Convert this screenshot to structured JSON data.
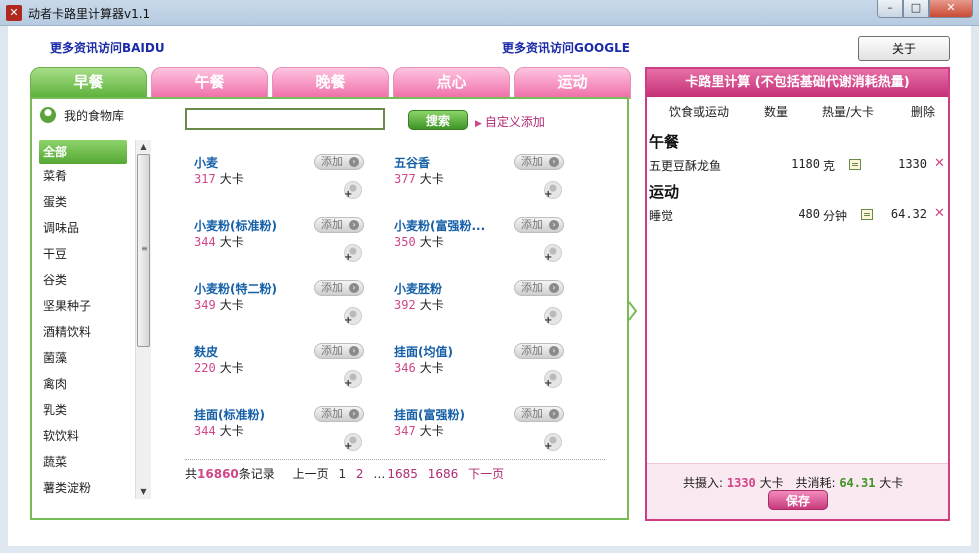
{
  "window": {
    "title": "动者卡路里计算器v1.1",
    "minimize": "–",
    "maximize": "□",
    "close": "✕"
  },
  "header": {
    "baidu_link": "更多资讯访问BAIDU",
    "google_link": "更多资讯访问GOOGLE",
    "about_button": "关于"
  },
  "tabs": [
    {
      "label": "早餐",
      "active": true
    },
    {
      "label": "午餐",
      "active": false
    },
    {
      "label": "晚餐",
      "active": false
    },
    {
      "label": "点心",
      "active": false
    },
    {
      "label": "运动",
      "active": false
    }
  ],
  "library": {
    "label": "我的食物库",
    "search_value": "",
    "search_button": "搜索",
    "custom_add": "自定义添加"
  },
  "categories": [
    "全部",
    "菜肴",
    "蛋类",
    "调味品",
    "干豆",
    "谷类",
    "坚果种子",
    "酒精饮料",
    "菌藻",
    "禽肉",
    "乳类",
    "软饮料",
    "蔬菜",
    "薯类淀粉"
  ],
  "foods": [
    {
      "name": "小麦",
      "kcal": "317",
      "unit": "大卡"
    },
    {
      "name": "五谷香",
      "kcal": "377",
      "unit": "大卡"
    },
    {
      "name": "小麦粉(标准粉)",
      "kcal": "344",
      "unit": "大卡"
    },
    {
      "name": "小麦粉(富强粉...",
      "kcal": "350",
      "unit": "大卡"
    },
    {
      "name": "小麦粉(特二粉)",
      "kcal": "349",
      "unit": "大卡"
    },
    {
      "name": "小麦胚粉",
      "kcal": "392",
      "unit": "大卡"
    },
    {
      "name": "麸皮",
      "kcal": "220",
      "unit": "大卡"
    },
    {
      "name": "挂面(均值)",
      "kcal": "346",
      "unit": "大卡"
    },
    {
      "name": "挂面(标准粉)",
      "kcal": "344",
      "unit": "大卡"
    },
    {
      "name": "挂面(富强粉)",
      "kcal": "347",
      "unit": "大卡"
    }
  ],
  "add_label": "添加",
  "pager": {
    "prefix": "共",
    "total": "16860",
    "suffix": "条记录",
    "prev": "上一页",
    "p1": "1",
    "p2": "2",
    "dots": "…",
    "p1685": "1685",
    "p1686": "1686",
    "next": "下一页"
  },
  "calc": {
    "title": "卡路里计算 (不包括基础代谢消耗热量)",
    "col_item": "饮食或运动",
    "col_qty": "数量",
    "col_cal": "热量/大卡",
    "col_del": "删除",
    "sections": [
      {
        "title": "午餐",
        "items": [
          {
            "name": "五更豆酥龙鱼",
            "qty": "1180",
            "unit": "克",
            "cal": "1330"
          }
        ]
      },
      {
        "title": "运动",
        "items": [
          {
            "name": "睡觉",
            "qty": "480",
            "unit": "分钟",
            "cal": "64.32"
          }
        ]
      }
    ],
    "summary": {
      "intake_label": "共摄入:",
      "intake_value": "1330",
      "intake_unit": "大卡",
      "burn_label": "共消耗:",
      "burn_value": "64.31",
      "burn_unit": "大卡"
    },
    "save_button": "保存"
  },
  "colors": {
    "green": "#5bb03a",
    "pink": "#cf3e84",
    "link_blue": "#1a2aa8",
    "food_blue": "#1660a8"
  }
}
